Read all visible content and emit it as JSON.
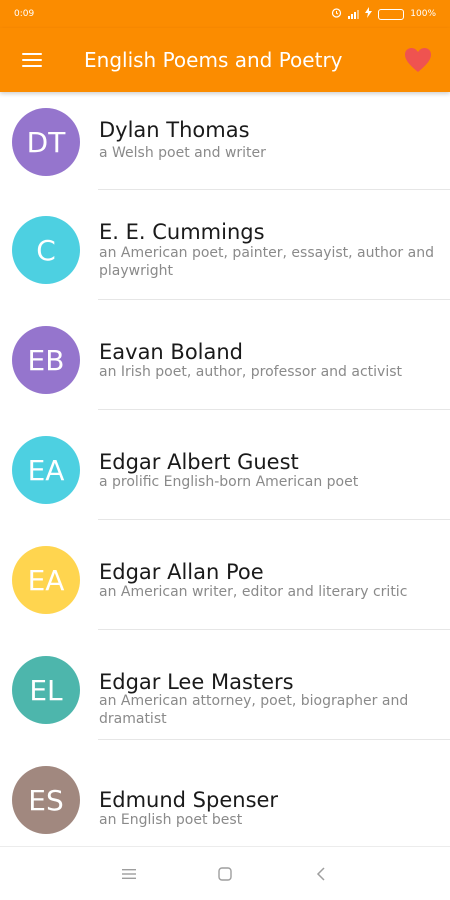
{
  "status_bar": {
    "time": "0:09",
    "battery": "100%"
  },
  "app_bar": {
    "title": "English Poems and Poetry",
    "menu_icon": "hamburger-icon",
    "favorite_icon": "heart-icon"
  },
  "colors": {
    "primary": "#fb8c00",
    "heart": "#ef5350",
    "purple": "#9575cd",
    "cyan": "#4dd0e1",
    "yellow": "#ffd54f",
    "teal": "#4db6ac",
    "brown": "#a1887f"
  },
  "poets": [
    {
      "initials": "DT",
      "name": "Dylan Thomas",
      "description": "a Welsh poet and writer",
      "color": "#9575cd"
    },
    {
      "initials": "C",
      "name": "E. E. Cummings",
      "description": "an American poet, painter, essayist, author and playwright",
      "color": "#4dd0e1"
    },
    {
      "initials": "EB",
      "name": "Eavan Boland",
      "description": "an Irish poet, author, professor and activist",
      "color": "#9575cd"
    },
    {
      "initials": "EA",
      "name": "Edgar Albert Guest",
      "description": "a prolific English-born American poet",
      "color": "#4dd0e1"
    },
    {
      "initials": "EA",
      "name": "Edgar Allan Poe",
      "description": "an American writer, editor and literary critic",
      "color": "#ffd54f"
    },
    {
      "initials": "EL",
      "name": "Edgar Lee Masters",
      "description": "an American attorney, poet, biographer and dramatist",
      "color": "#4db6ac"
    },
    {
      "initials": "ES",
      "name": "Edmund Spenser",
      "description": "an English poet best",
      "color": "#a1887f"
    }
  ],
  "nav_bar": {
    "recents_icon": "recents-icon",
    "home_icon": "home-icon",
    "back_icon": "back-icon"
  }
}
